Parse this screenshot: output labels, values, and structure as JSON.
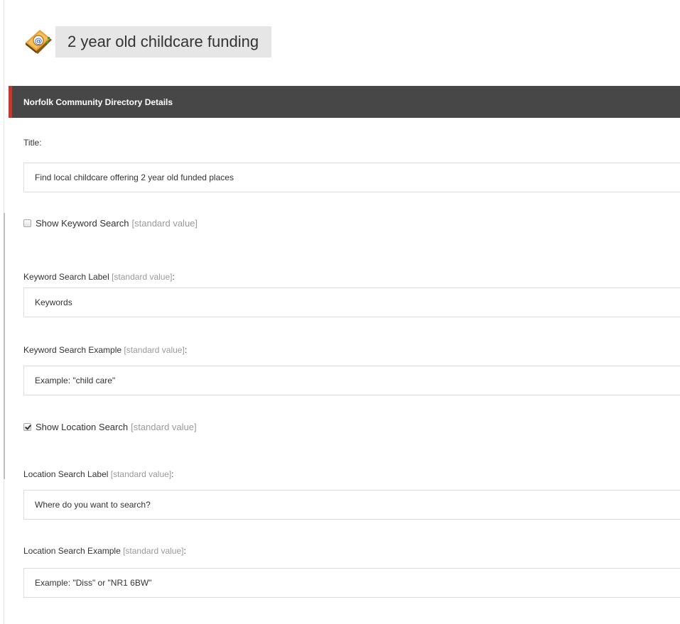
{
  "item": {
    "title": "2 year old childcare funding",
    "icon": "address-book-icon"
  },
  "section": {
    "title": "Norfolk Community Directory Details",
    "accent_color": "#c8362e"
  },
  "standard_value_tag": "[standard value]",
  "fields": {
    "title": {
      "label": "Title:",
      "value": "Find local childcare offering 2 year old funded places"
    },
    "show_keyword_search": {
      "label": "Show Keyword Search",
      "checked": false
    },
    "keyword_search_label": {
      "label": "Keyword Search Label",
      "value": "Keywords"
    },
    "keyword_search_example": {
      "label": "Keyword Search Example",
      "value": "Example: \"child care\""
    },
    "show_location_search": {
      "label": "Show Location Search",
      "checked": true
    },
    "location_search_label": {
      "label": "Location Search Label",
      "value": "Where do you want to search?"
    },
    "location_search_example": {
      "label": "Location Search Example",
      "value": "Example: \"Diss\" or \"NR1 6BW\""
    }
  }
}
